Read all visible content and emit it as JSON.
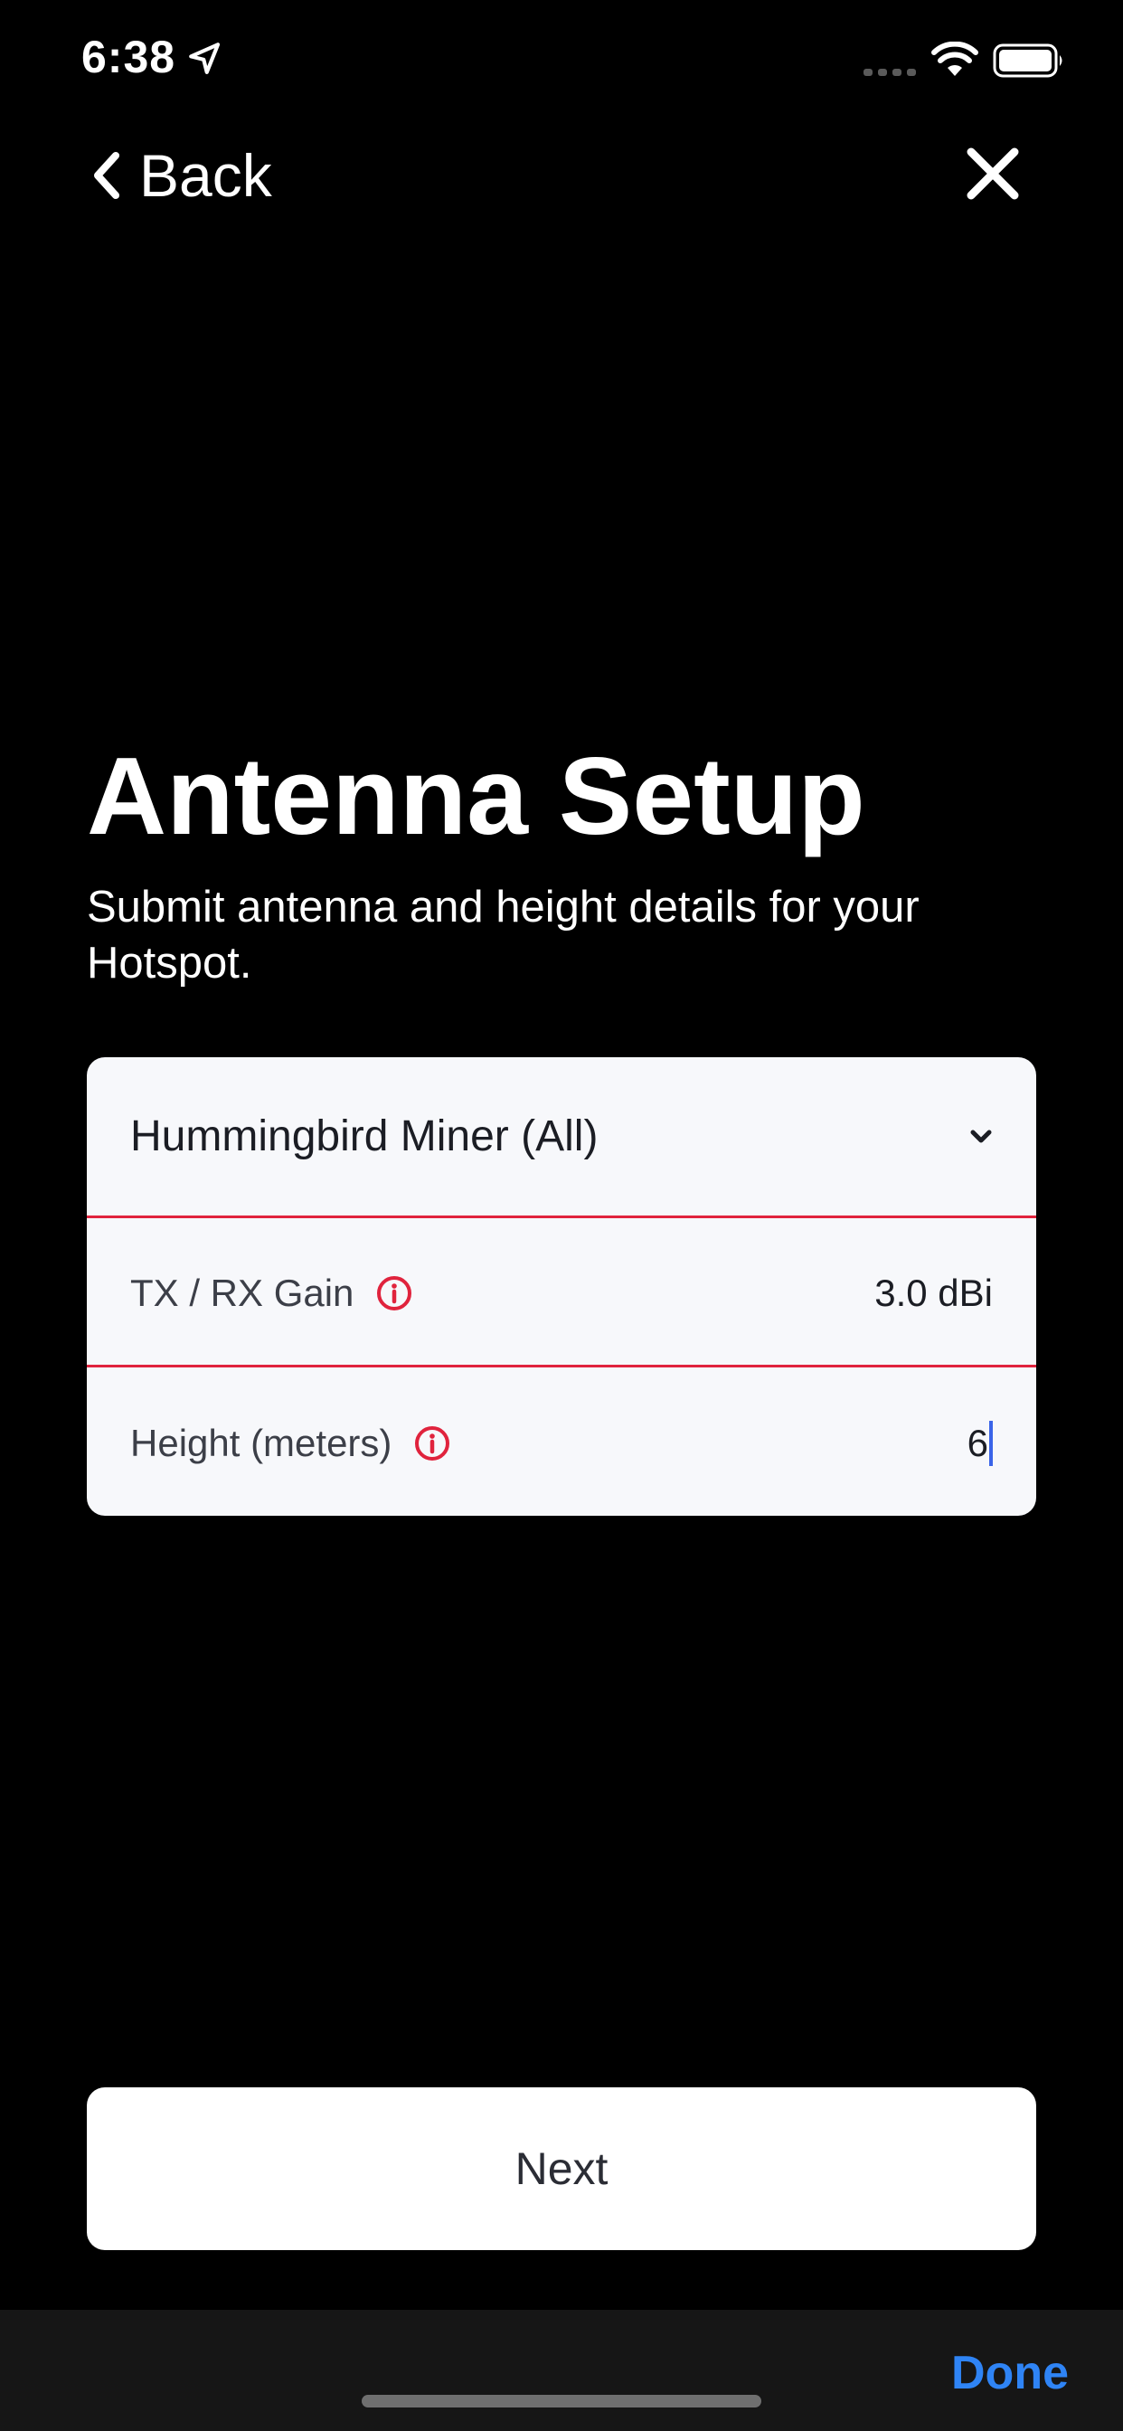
{
  "status_bar": {
    "time": "6:38"
  },
  "nav": {
    "back_label": "Back"
  },
  "header": {
    "title": "Antenna Setup",
    "subtitle": "Submit antenna and height details for your Hotspot."
  },
  "form": {
    "antenna_select": {
      "selected": "Hummingbird Miner (All)"
    },
    "gain": {
      "label": "TX / RX Gain",
      "value": "3.0 dBi"
    },
    "height": {
      "label": "Height (meters)",
      "value": "6"
    }
  },
  "actions": {
    "next_label": "Next"
  },
  "keyboard_accessory": {
    "done_label": "Done"
  },
  "colors": {
    "background": "#000000",
    "card": "#f7f8fb",
    "divider": "#e0233d",
    "info_icon": "#e0233d",
    "cursor": "#3a64e8",
    "done": "#2f84f5"
  }
}
